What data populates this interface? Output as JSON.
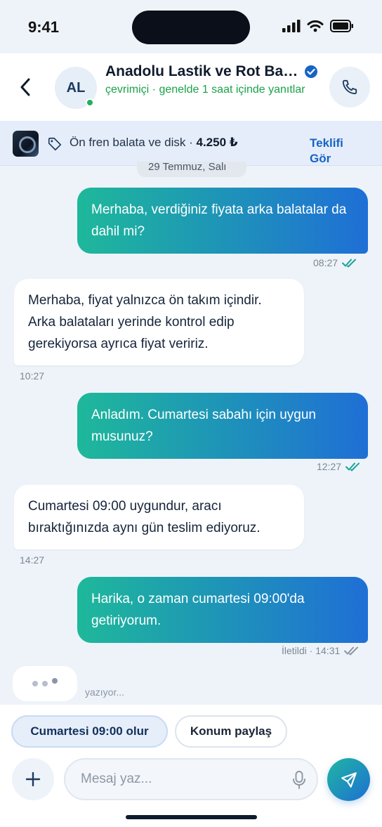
{
  "status_bar": {
    "time": "9:41"
  },
  "header": {
    "avatar_initials": "AL",
    "contact_name": "Anadolu Lastik ve Rot Bakım Servisi",
    "presence": "çevrimiçi · genelde 1 saat içinde yanıtlar"
  },
  "offer": {
    "description": "Ön fren balata ve disk · ",
    "price": "4.250 ₺",
    "link_label": "Teklifi Gör"
  },
  "chat": {
    "date_label": "29 Temmuz, Salı",
    "messages": [
      {
        "direction": "out",
        "text": "Merhaba, verdiğiniz fiyata arka balatalar da dahil mi?",
        "time": "08:27"
      },
      {
        "direction": "in",
        "text": "Merhaba, fiyat yalnızca ön takım içindir. Arka balataları yerinde kontrol edip gerekiyorsa ayrıca fiyat veririz.",
        "time": "10:27"
      },
      {
        "direction": "out",
        "text": "Anladım. Cumartesi sabahı için uygun musunuz?",
        "time": "12:27"
      },
      {
        "direction": "in",
        "text": "Cumartesi 09:00 uygundur, aracı bıraktığınızda aynı gün teslim ediyoruz.",
        "time": "14:27"
      },
      {
        "direction": "out",
        "text": "Harika, o zaman cumartesi 09:00'da getiriyorum.",
        "time": "İletildi · 14:31"
      }
    ],
    "typing_label": "yazıyor..."
  },
  "quick_replies": [
    "Cumartesi 09:00 olur",
    "Konum paylaş"
  ],
  "composer": {
    "placeholder": "Mesaj yaz..."
  },
  "colors": {
    "accent_start": "#1eb89a",
    "accent_end": "#1f6fd6",
    "online": "#22b25a",
    "verified": "#1763c6",
    "read_ticks": "#1aa39a"
  },
  "icons": [
    "back-chevron-icon",
    "verified-badge-icon",
    "phone-icon",
    "tag-icon",
    "double-check-icon",
    "plus-icon",
    "mic-icon",
    "send-icon",
    "signal-icon",
    "wifi-icon",
    "battery-icon"
  ]
}
